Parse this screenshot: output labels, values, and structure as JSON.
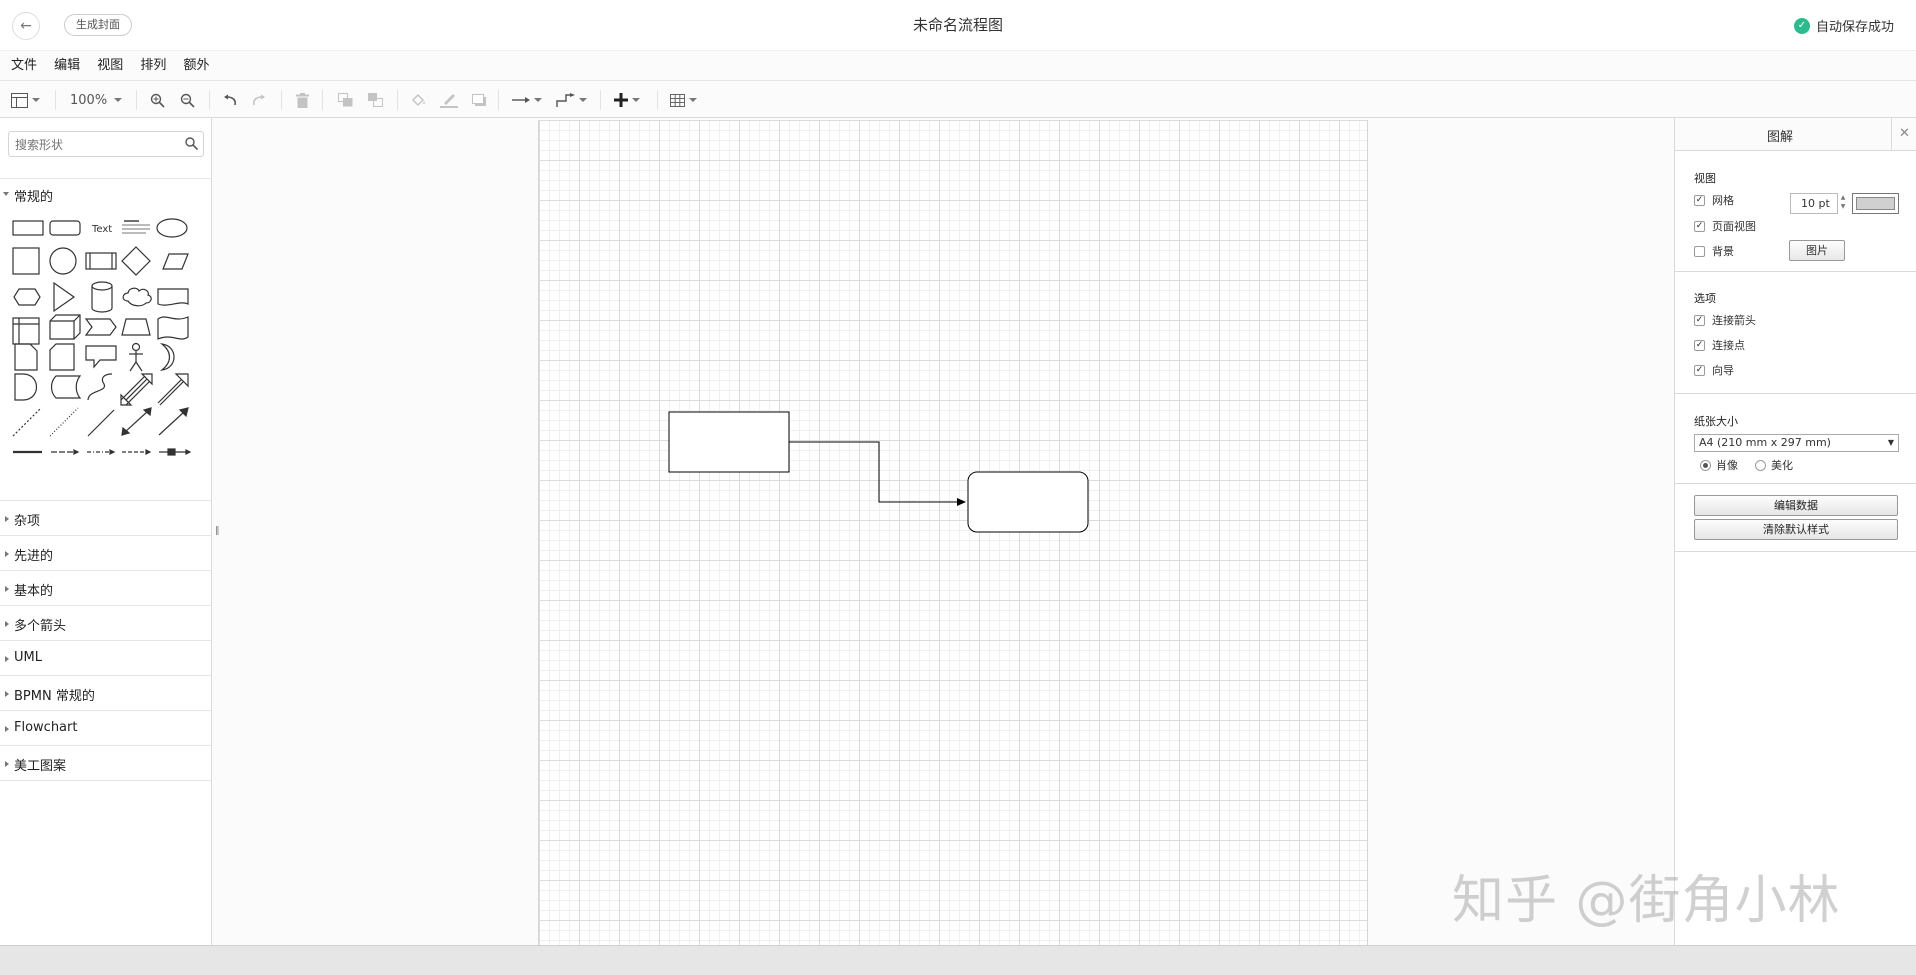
{
  "topbar": {
    "back_icon": "arrow-left-icon",
    "cover_button": "生成封面",
    "title": "未命名流程图",
    "save_status": "自动保存成功",
    "status_color": "#2bbb8f"
  },
  "menu": [
    "文件",
    "编辑",
    "视图",
    "排列",
    "额外"
  ],
  "toolbar": {
    "zoom": "100%",
    "icons": [
      "format-panel-icon",
      "zoom-in-icon",
      "zoom-out-icon",
      "undo-icon",
      "redo-icon",
      "delete-icon",
      "to-front-icon",
      "to-back-icon",
      "fill-color-icon",
      "line-color-icon",
      "shadow-icon",
      "connection-icon",
      "waypoints-icon",
      "insert-plus-icon",
      "table-icon"
    ]
  },
  "sidebar": {
    "search_placeholder": "搜索形状",
    "open_category": "常规的",
    "shape_text": "Text",
    "categories": [
      "杂项",
      "先进的",
      "基本的",
      "多个箭头",
      "UML",
      "BPMN 常规的",
      "Flowchart",
      "美工图案"
    ]
  },
  "panel": {
    "title": "图解",
    "view_section": {
      "title": "视图",
      "grid_label": "网格",
      "grid_checked": true,
      "grid_size": "10 pt",
      "grid_color": "#d0d0d0",
      "page_view_label": "页面视图",
      "page_view_checked": true,
      "background_label": "背景",
      "background_checked": false,
      "image_button": "图片"
    },
    "options_section": {
      "title": "选项",
      "items": [
        {
          "label": "连接箭头",
          "checked": true
        },
        {
          "label": "连接点",
          "checked": true
        },
        {
          "label": "向导",
          "checked": true
        }
      ]
    },
    "paper_section": {
      "title": "纸张大小",
      "size": "A4 (210 mm x 297 mm)",
      "portrait": "肖像",
      "landscape": "美化",
      "selected": "portrait"
    },
    "edit_data_button": "编辑数据",
    "clear_style_button": "清除默认样式"
  },
  "watermark": "知乎 @街角小林"
}
